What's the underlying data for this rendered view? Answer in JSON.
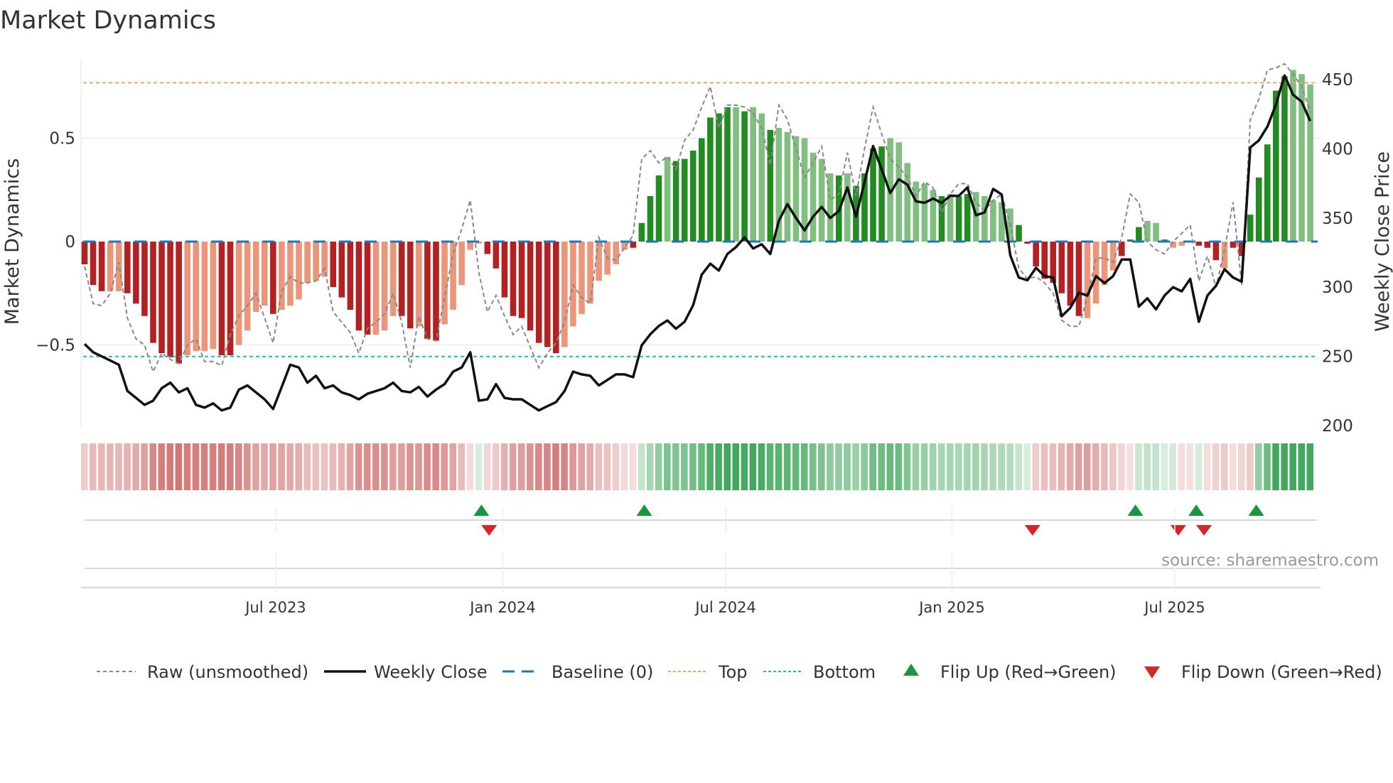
{
  "title": "Market Dynamics",
  "source": "source: sharemaestro.com",
  "colors": {
    "bar_dark_red": "#b22222",
    "bar_light_red": "#e9967a",
    "bar_dark_green": "#228b22",
    "bar_light_green": "#80bf80",
    "raw": "#888888",
    "close": "#111111",
    "baseline": "#1f77b4",
    "top": "#f4a460",
    "bottom": "#17becf",
    "flip_up": "#1a9641",
    "flip_down": "#d62728",
    "strip_red": "#c85a5a",
    "strip_green": "#2f9e4c"
  },
  "chart_data": {
    "type": "bar",
    "title": "Market Dynamics",
    "ylabel": "Market Dynamics",
    "y2label": "Weekly Close Price",
    "ylim": [
      -0.92,
      0.88
    ],
    "y2lim": [
      200,
      465
    ],
    "yticks": [
      {
        "v": 0.5,
        "label": "0.5"
      },
      {
        "v": 0,
        "label": "0"
      },
      {
        "v": -0.5,
        "label": "−0.5"
      }
    ],
    "y2ticks": [
      {
        "v": 450,
        "label": "450"
      },
      {
        "v": 400,
        "label": "400"
      },
      {
        "v": 350,
        "label": "350"
      },
      {
        "v": 300,
        "label": "300"
      },
      {
        "v": 250,
        "label": "250"
      },
      {
        "v": 200,
        "label": "200"
      }
    ],
    "xticks": [
      {
        "week": 22.3,
        "label": "Jul 2023"
      },
      {
        "week": 48.8,
        "label": "Jan 2024"
      },
      {
        "week": 74.8,
        "label": "Jul 2024"
      },
      {
        "week": 101.2,
        "label": "Jan 2025"
      },
      {
        "week": 127.2,
        "label": "Jul 2025"
      }
    ],
    "top_level": 0.768,
    "bottom_level": -0.556,
    "baseline": 0,
    "dynamics": [
      -0.11,
      -0.21,
      -0.24,
      -0.24,
      -0.24,
      -0.25,
      -0.3,
      -0.36,
      -0.49,
      -0.54,
      -0.56,
      -0.59,
      -0.55,
      -0.53,
      -0.53,
      -0.52,
      -0.55,
      -0.55,
      -0.5,
      -0.43,
      -0.34,
      -0.31,
      -0.35,
      -0.33,
      -0.31,
      -0.28,
      -0.2,
      -0.19,
      -0.17,
      -0.22,
      -0.27,
      -0.33,
      -0.43,
      -0.45,
      -0.45,
      -0.43,
      -0.36,
      -0.36,
      -0.42,
      -0.41,
      -0.47,
      -0.48,
      -0.4,
      -0.33,
      -0.21,
      -0.04,
      -0.01,
      -0.06,
      -0.13,
      -0.27,
      -0.36,
      -0.37,
      -0.43,
      -0.49,
      -0.51,
      -0.54,
      -0.51,
      -0.41,
      -0.35,
      -0.3,
      -0.19,
      -0.16,
      -0.11,
      -0.04,
      -0.03,
      0.09,
      0.22,
      0.32,
      0.41,
      0.39,
      0.4,
      0.44,
      0.5,
      0.6,
      0.62,
      0.65,
      0.65,
      0.63,
      0.65,
      0.62,
      0.54,
      0.55,
      0.53,
      0.51,
      0.5,
      0.43,
      0.4,
      0.33,
      0.32,
      0.33,
      0.27,
      0.33,
      0.45,
      0.46,
      0.5,
      0.48,
      0.38,
      0.29,
      0.28,
      0.25,
      0.22,
      0.23,
      0.22,
      0.23,
      0.24,
      0.22,
      0.2,
      0.19,
      0.16,
      0.08,
      -0.01,
      -0.12,
      -0.18,
      -0.2,
      -0.25,
      -0.31,
      -0.36,
      -0.37,
      -0.3,
      -0.21,
      -0.14,
      -0.07,
      0.01,
      0.07,
      0.1,
      0.09,
      0.01,
      -0.03,
      -0.02,
      0.005,
      -0.02,
      -0.03,
      -0.09,
      -0.13,
      -0.03,
      -0.07,
      0.13,
      0.31,
      0.47,
      0.73,
      0.8,
      0.83,
      0.81,
      0.76
    ],
    "strong": [
      1,
      1,
      1,
      0,
      0,
      1,
      1,
      1,
      1,
      1,
      1,
      1,
      0,
      0,
      0,
      0,
      1,
      1,
      0,
      0,
      0,
      0,
      1,
      0,
      0,
      0,
      0,
      0,
      0,
      1,
      1,
      1,
      1,
      1,
      0,
      0,
      0,
      1,
      1,
      0,
      1,
      1,
      0,
      0,
      0,
      0,
      0,
      1,
      1,
      1,
      1,
      1,
      1,
      1,
      1,
      1,
      0,
      0,
      0,
      0,
      0,
      0,
      0,
      0,
      1,
      1,
      1,
      1,
      0,
      1,
      1,
      1,
      1,
      1,
      1,
      1,
      0,
      1,
      0,
      0,
      1,
      0,
      0,
      0,
      0,
      0,
      0,
      0,
      1,
      0,
      1,
      1,
      1,
      1,
      0,
      0,
      0,
      0,
      0,
      0,
      1,
      0,
      1,
      1,
      0,
      0,
      0,
      0,
      0,
      1,
      1,
      1,
      1,
      1,
      1,
      1,
      1,
      0,
      0,
      0,
      0,
      1,
      1,
      1,
      0,
      0,
      1,
      0,
      0,
      1,
      1,
      1,
      1,
      0,
      1,
      1,
      1,
      1,
      1,
      1,
      1,
      0,
      0
    ],
    "raw": [
      -0.12,
      -0.3,
      -0.31,
      -0.25,
      -0.1,
      -0.37,
      -0.47,
      -0.5,
      -0.63,
      -0.54,
      -0.57,
      -0.59,
      -0.5,
      -0.47,
      -0.58,
      -0.58,
      -0.6,
      -0.45,
      -0.36,
      -0.31,
      -0.25,
      -0.37,
      -0.49,
      -0.24,
      -0.17,
      -0.2,
      -0.2,
      -0.19,
      -0.13,
      -0.34,
      -0.39,
      -0.44,
      -0.54,
      -0.42,
      -0.39,
      -0.35,
      -0.25,
      -0.39,
      -0.61,
      -0.36,
      -0.47,
      -0.48,
      -0.27,
      -0.06,
      0.06,
      0.2,
      -0.15,
      -0.34,
      -0.26,
      -0.36,
      -0.45,
      -0.41,
      -0.51,
      -0.61,
      -0.54,
      -0.49,
      -0.39,
      -0.21,
      -0.27,
      -0.3,
      0.02,
      -0.08,
      -0.09,
      -0.03,
      0.03,
      0.4,
      0.44,
      0.38,
      0.41,
      0.35,
      0.49,
      0.54,
      0.65,
      0.75,
      0.55,
      0.66,
      0.66,
      0.65,
      0.62,
      0.55,
      0.37,
      0.66,
      0.59,
      0.45,
      0.31,
      0.38,
      0.46,
      0.2,
      0.23,
      0.43,
      0.22,
      0.45,
      0.65,
      0.52,
      0.4,
      0.36,
      0.31,
      0.22,
      0.29,
      0.26,
      0.14,
      0.23,
      0.28,
      0.28,
      0.19,
      0.15,
      0.2,
      0.23,
      0.08,
      -0.13,
      -0.18,
      -0.17,
      -0.2,
      -0.25,
      -0.38,
      -0.41,
      -0.41,
      -0.27,
      -0.08,
      -0.08,
      -0.1,
      0.02,
      0.23,
      0.19,
      0.0,
      -0.04,
      -0.06,
      0.0,
      0.04,
      0.08,
      -0.19,
      -0.07,
      -0.22,
      -0.04,
      0.19,
      -0.21,
      0.59,
      0.69,
      0.83,
      0.84,
      0.86,
      0.81,
      0.75,
      0.63
    ],
    "weekly_close": [
      259,
      253,
      250,
      247,
      244,
      225,
      220,
      215,
      218,
      227,
      231,
      224,
      227,
      215,
      213,
      216,
      211,
      213,
      226,
      229,
      224,
      219,
      212,
      228,
      244,
      242,
      231,
      236,
      227,
      229,
      224,
      222,
      219,
      223,
      225,
      227,
      231,
      225,
      224,
      228,
      221,
      226,
      230,
      239,
      242,
      253,
      218,
      219,
      230,
      220,
      219,
      219,
      215,
      211,
      214,
      217,
      225,
      239,
      237,
      236,
      229,
      233,
      237,
      237,
      235,
      258,
      266,
      272,
      276,
      270,
      275,
      287,
      309,
      317,
      312,
      324,
      329,
      336,
      328,
      331,
      324,
      348,
      360,
      350,
      341,
      351,
      358,
      350,
      355,
      372,
      351,
      376,
      402,
      385,
      368,
      378,
      374,
      362,
      361,
      364,
      361,
      366,
      366,
      372,
      352,
      354,
      371,
      367,
      323,
      307,
      305,
      314,
      308,
      307,
      279,
      285,
      296,
      294,
      308,
      303,
      308,
      320,
      320,
      286,
      292,
      284,
      294,
      300,
      297,
      306,
      275,
      294,
      301,
      313,
      307,
      304,
      401,
      406,
      416,
      432,
      453,
      439,
      434,
      420
    ],
    "flip_up_weeks": [
      46.3,
      65.3,
      122.6,
      129.7,
      136.7
    ],
    "flip_down_weeks": [
      47.2,
      110.6,
      127.6,
      130.6
    ],
    "legend": {
      "placement": "bottom",
      "raw": "Raw (unsmoothed)",
      "close": "Weekly Close",
      "baseline": "Baseline (0)",
      "top": "Top",
      "bottom": "Bottom",
      "flip_up": "Flip Up (Red→Green)",
      "flip_down": "Flip Down (Green→Red)"
    }
  }
}
